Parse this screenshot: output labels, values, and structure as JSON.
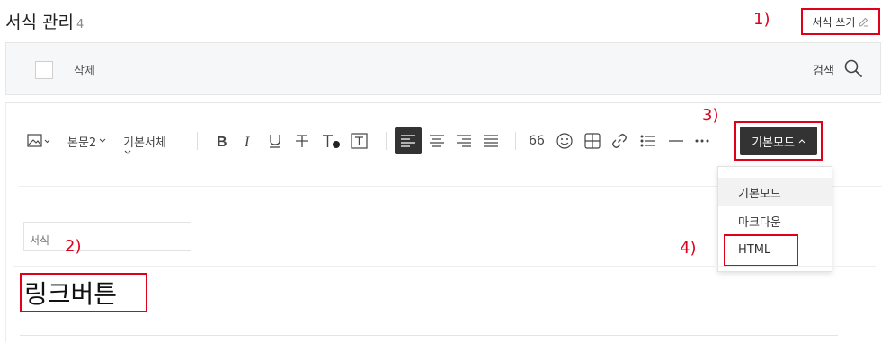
{
  "header": {
    "title": "서식 관리",
    "count": "4",
    "write_label": "서식 쓰기"
  },
  "annotations": {
    "a1": "1)",
    "a2": "2)",
    "a3": "3)",
    "a4": "4)"
  },
  "list_bar": {
    "delete_label": "삭제",
    "search_label": "검색"
  },
  "toolbar": {
    "paragraph_style": "본문2",
    "font_family": "기본서체",
    "quote_glyph": "66",
    "mode_label": "기본모드"
  },
  "mode_menu": {
    "items": [
      "기본모드",
      "마크다운",
      "HTML"
    ],
    "selected": "기본모드"
  },
  "editor": {
    "title_placeholder": "서식",
    "content_text": "링크버튼"
  },
  "colors": {
    "annotation_red": "#e0001b",
    "dark_button": "#333333"
  }
}
